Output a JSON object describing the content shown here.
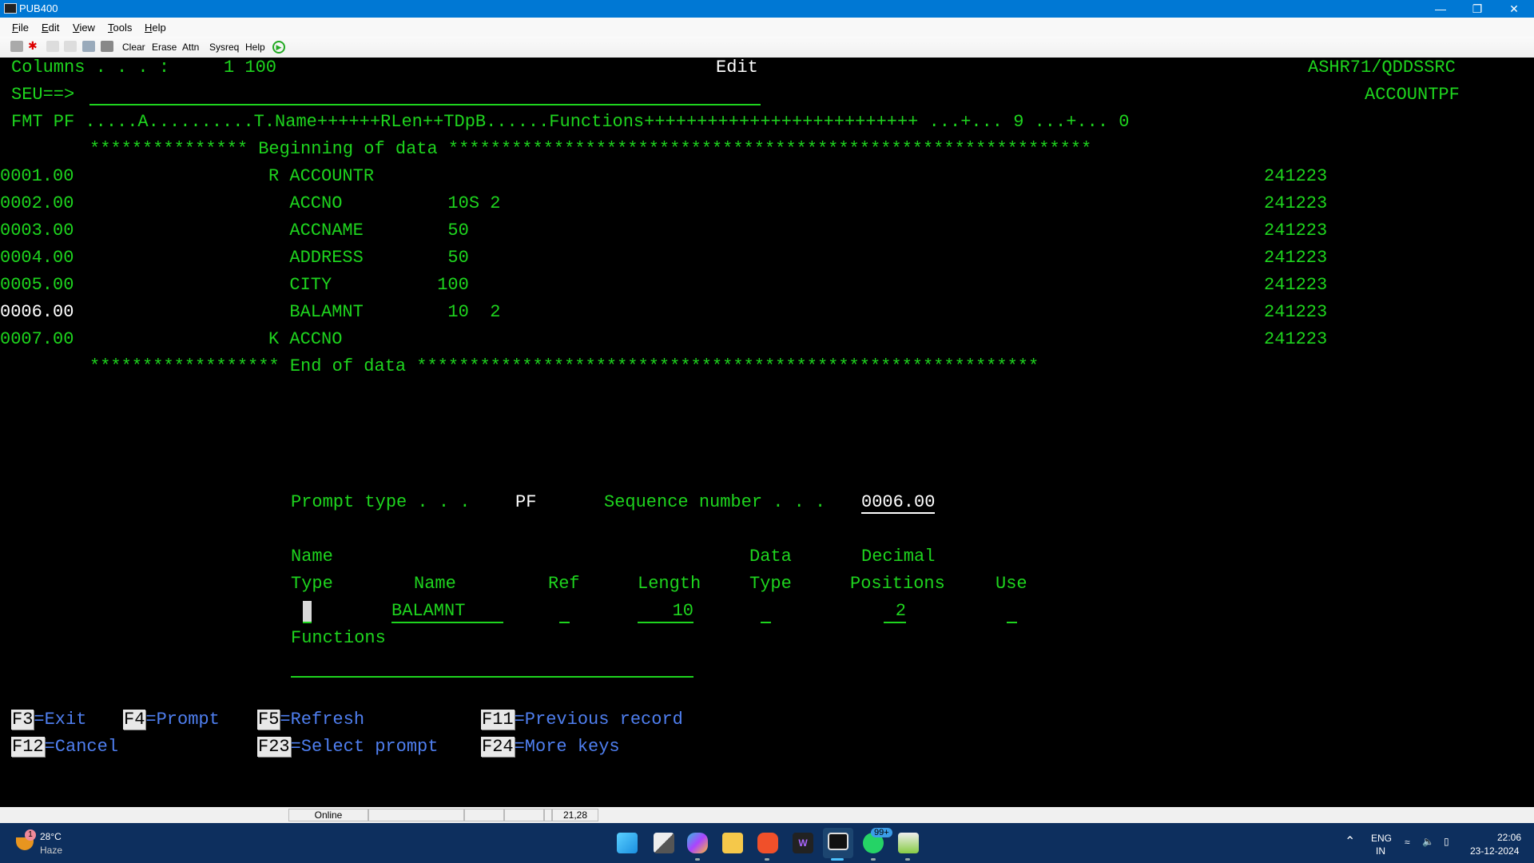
{
  "window": {
    "title": "PUB400",
    "controls": [
      "minimize",
      "restore",
      "close"
    ]
  },
  "menu": [
    "File",
    "Edit",
    "View",
    "Tools",
    "Help"
  ],
  "toolbar": {
    "icons": [
      "terminal-icon",
      "disconnect-icon",
      "copy-icon",
      "paste-icon",
      "print-icon",
      "camera-icon"
    ],
    "buttons": [
      "Clear",
      "Erase",
      "Attn",
      "Sysreq",
      "Help"
    ],
    "play_icon": "play-icon"
  },
  "screen": {
    "columns_label": "Columns . . . :",
    "columns_value": "1 100",
    "mode": "Edit",
    "source_file": "ASHR71/QDDSSRC",
    "member": "ACCOUNTPF",
    "command_prompt": "SEU==>",
    "command_value": "",
    "format_line": "FMT PF .....A..........T.Name++++++RLen++TDpB......Functions++++++++++++++++++++++++++ ...+... 9 ...+... 0",
    "begin_line": "*************** Beginning of data *************************************************************",
    "end_line": "****************** End of data ***********************************************************",
    "records": [
      {
        "seq": "0001.00",
        "text": "R ACCOUNTR",
        "date": "241223"
      },
      {
        "seq": "0002.00",
        "text": "  ACCNO          10S 2",
        "date": "241223"
      },
      {
        "seq": "0003.00",
        "text": "  ACCNAME        50",
        "date": "241223"
      },
      {
        "seq": "0004.00",
        "text": "  ADDRESS        50",
        "date": "241223"
      },
      {
        "seq": "0005.00",
        "text": "  CITY          100",
        "date": "241223"
      },
      {
        "seq": "0006.00",
        "text": "  BALAMNT        10  2",
        "date": "241223",
        "current": true
      },
      {
        "seq": "0007.00",
        "text": "K ACCNO",
        "date": "241223"
      }
    ],
    "prompt": {
      "prompt_type_label": "Prompt type . . .",
      "prompt_type_value": "PF",
      "sequence_label": "Sequence number . . .",
      "sequence_value": "0006.00",
      "headers": {
        "name_type_1": "Name",
        "name_type_2": "Type",
        "name": "Name",
        "ref": "Ref",
        "length": "Length",
        "data_type_1": "Data",
        "data_type_2": "Type",
        "decimal_1": "Decimal",
        "decimal_2": "Positions",
        "use": "Use"
      },
      "values": {
        "name_type": "",
        "name": "BALAMNT",
        "ref": "",
        "length": "10",
        "data_type": "",
        "decimal": "2",
        "use": ""
      },
      "functions_label": "Functions",
      "functions_value": ""
    },
    "fkeys": [
      {
        "key": "F3",
        "label": "=Exit"
      },
      {
        "key": "F4",
        "label": "=Prompt"
      },
      {
        "key": "F5",
        "label": "=Refresh"
      },
      {
        "key": "F11",
        "label": "=Previous record"
      },
      {
        "key": "F12",
        "label": "=Cancel"
      },
      {
        "key": "F23",
        "label": "=Select prompt"
      },
      {
        "key": "F24",
        "label": "=More keys"
      }
    ]
  },
  "statusbar": {
    "status": "Online",
    "cursor_position": "21,28"
  },
  "taskbar": {
    "weather": {
      "temp": "28°C",
      "condition": "Haze",
      "badge": "1"
    },
    "apps": [
      "start",
      "task-view",
      "copilot",
      "file-explorer",
      "brave",
      "winamp",
      "terminal-emulator",
      "whatsapp",
      "notepad"
    ],
    "whatsapp_badge": "99+",
    "lang_1": "ENG",
    "lang_2": "IN",
    "time": "22:06",
    "date": "23-12-2024"
  }
}
